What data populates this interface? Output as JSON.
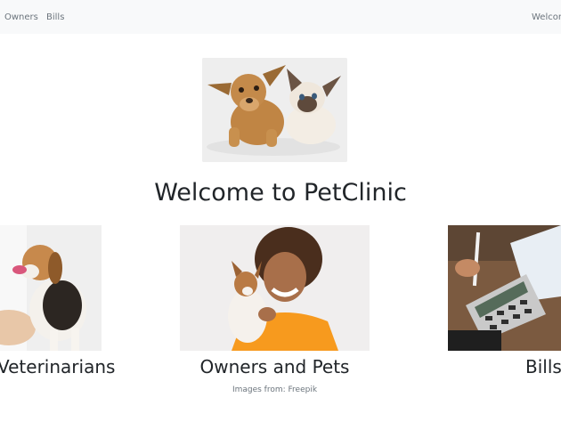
{
  "nav": {
    "owners": "Owners",
    "bills": "Bills",
    "welcome": "Welcome"
  },
  "main": {
    "title": "Welcome to PetClinic",
    "cards": [
      {
        "label": "Veterinarians"
      },
      {
        "label": "Owners and Pets"
      },
      {
        "label": "Bills"
      }
    ],
    "credit": "Images from: Freepik"
  },
  "colors": {
    "navbar_bg": "#f8f9fa",
    "text": "#212529",
    "muted": "#6c757d"
  }
}
